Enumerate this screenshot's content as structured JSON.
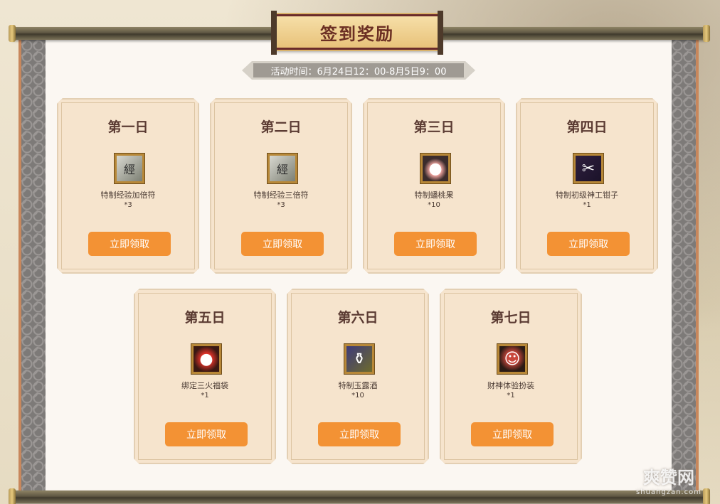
{
  "title": "签到奖励",
  "event_time": "活动时间：6月24日12：00-8月5日9：00",
  "claim_label": "立即领取",
  "days": [
    {
      "day": "第一日",
      "item": "特制经验加倍符",
      "qty": "*3",
      "icon": "exp-scroll-icon",
      "glyph": "經"
    },
    {
      "day": "第二日",
      "item": "特制经验三倍符",
      "qty": "*3",
      "icon": "exp-scroll-icon",
      "glyph": "經"
    },
    {
      "day": "第三日",
      "item": "特制蟠桃果",
      "qty": "*10",
      "icon": "peach-icon",
      "glyph": "●"
    },
    {
      "day": "第四日",
      "item": "特制初级神工钳子",
      "qty": "*1",
      "icon": "pliers-icon",
      "glyph": "✂"
    },
    {
      "day": "第五日",
      "item": "绑定三火福袋",
      "qty": "*1",
      "icon": "lucky-bag-icon",
      "glyph": "●"
    },
    {
      "day": "第六日",
      "item": "特制玉露酒",
      "qty": "*10",
      "icon": "wine-jug-icon",
      "glyph": "⚱"
    },
    {
      "day": "第七日",
      "item": "财神体验扮装",
      "qty": "*1",
      "icon": "god-of-wealth-icon",
      "glyph": "☺"
    }
  ],
  "watermark": {
    "main": "爽赞网",
    "sub": "shuangzan.com"
  }
}
